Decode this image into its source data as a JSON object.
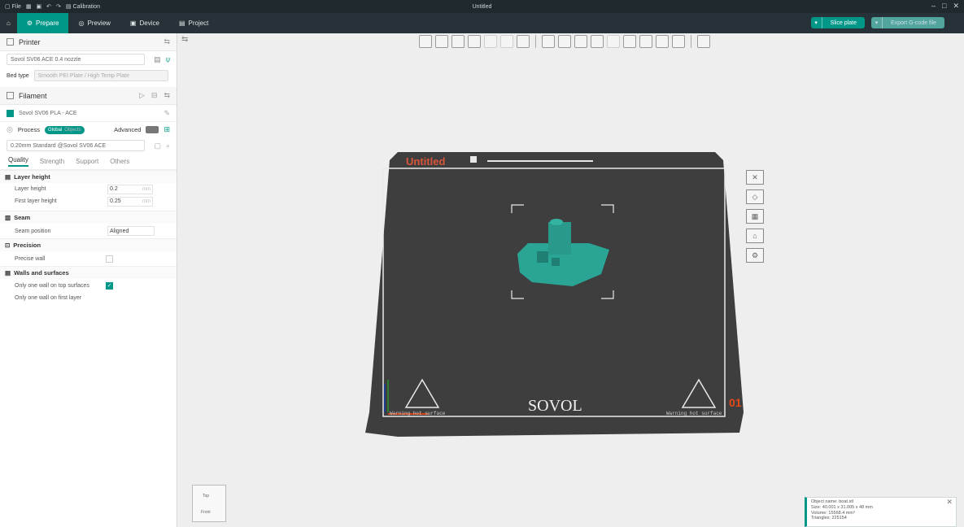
{
  "titlebar": {
    "file": "File",
    "calibration": "Calibration",
    "title": "Untitled",
    "minimize": "–",
    "maximize": "□",
    "close": "✕"
  },
  "tabs": {
    "prepare": "Prepare",
    "preview": "Preview",
    "device": "Device",
    "project": "Project"
  },
  "actions": {
    "slice_plate": "Slice plate",
    "export": "Export G-code file"
  },
  "printer": {
    "header": "Printer",
    "name": "Sovol SV06 ACE 0.4 nozzle",
    "bed_type_label": "Bed type",
    "bed_type_value": "Smooth PEI Plate / High Temp Plate"
  },
  "filament": {
    "header": "Filament",
    "item": "Sovol SV06 PLA - ACE"
  },
  "process": {
    "header": "Process",
    "global": "Global",
    "objects": "Objects",
    "advanced": "Advanced",
    "preset": "0.20mm Standard @Sovol SV06 ACE"
  },
  "subtabs": {
    "quality": "Quality",
    "strength": "Strength",
    "support": "Support",
    "others": "Others"
  },
  "groups": {
    "layer_height": "Layer height",
    "seam": "Seam",
    "precision": "Precision",
    "walls": "Walls and surfaces"
  },
  "props": {
    "layer_height": {
      "label": "Layer height",
      "value": "0.2",
      "unit": "mm"
    },
    "first_layer_height": {
      "label": "First layer height",
      "value": "0.25",
      "unit": "mm"
    },
    "seam_position": {
      "label": "Seam position",
      "value": "Aligned"
    },
    "precise_wall": {
      "label": "Precise wall"
    },
    "one_wall_top": {
      "label": "Only one wall on top surfaces"
    },
    "one_wall_first": {
      "label": "Only one wall on first layer"
    }
  },
  "plate": {
    "name": "Untitled",
    "brand": "SOVOL",
    "warning_left": "Warning hot surface",
    "warning_right": "Warning hot surface",
    "number": "01"
  },
  "minicube": {
    "top": "Top",
    "front": "Front"
  },
  "info": {
    "object_name": "Object name: boat.stl",
    "size": "Size: 40.001 x 31.005 x 48 mm",
    "volume": "Volume: 15568.4 mm³",
    "triangles": "Triangles: 225154"
  },
  "colors": {
    "accent": "#009688",
    "titlebar": "#1f2a2e",
    "tabbar": "#263238",
    "plate": "#3e3e3e",
    "model": "#2aa595"
  }
}
